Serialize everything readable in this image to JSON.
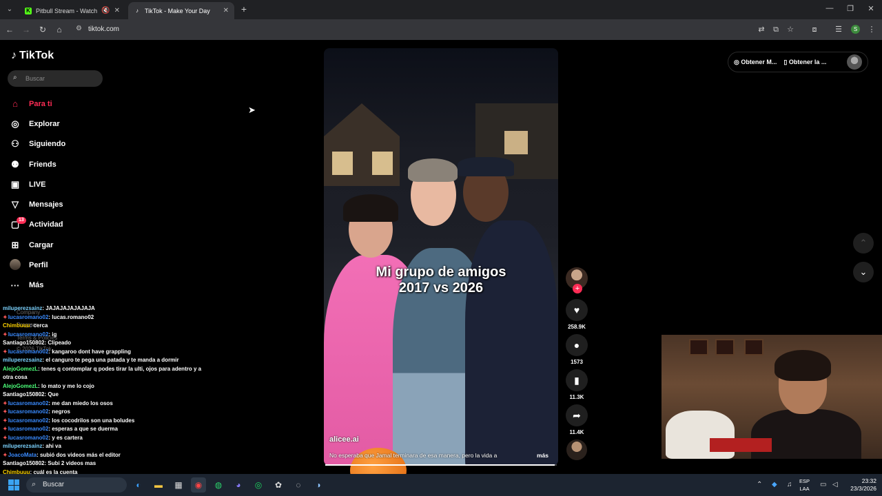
{
  "browser": {
    "tabs": [
      {
        "title": "Pitbull Stream - Watch Live",
        "favicon": "K",
        "color": "#53fc18"
      },
      {
        "title": "TikTok - Make Your Day",
        "favicon": "♪",
        "color": "#ffffff"
      }
    ],
    "url": "tiktok.com"
  },
  "tiktok": {
    "logo": "TikTok",
    "search_placeholder": "Buscar",
    "nav": [
      {
        "label": "Para ti",
        "icon": "home-icon",
        "active": true
      },
      {
        "label": "Explorar",
        "icon": "compass-icon"
      },
      {
        "label": "Siguiendo",
        "icon": "following-icon"
      },
      {
        "label": "Friends",
        "icon": "friends-icon"
      },
      {
        "label": "LIVE",
        "icon": "live-icon"
      },
      {
        "label": "Mensajes",
        "icon": "messages-icon"
      },
      {
        "label": "Actividad",
        "icon": "activity-icon",
        "badge": "13"
      },
      {
        "label": "Cargar",
        "icon": "upload-icon"
      },
      {
        "label": "Perfil",
        "icon": "avatar"
      },
      {
        "label": "Más",
        "icon": "more-icon"
      }
    ],
    "footer_ghost": [
      "Company",
      "Program",
      "Terms & Policies",
      "© 2026 TikTok"
    ],
    "top_buttons": {
      "get_coins": "Obtener M...",
      "get_app": "Obtener la ..."
    },
    "video": {
      "overlay_line1": "Mi grupo de amigos",
      "overlay_line2": "2017 vs 2026",
      "username": "alicee.ai",
      "description": "No esperaba que Jamal terminara de esa manera, pero la vida a",
      "more": "más",
      "progress": 0.99,
      "likes": "258.9K",
      "comments": "1573",
      "saves": "11.3K",
      "shares": "11.4K"
    }
  },
  "chat": [
    {
      "user": "miluperezsainz",
      "color": "#7cd3ff",
      "badges": false,
      "text": "JAJAJAJAJAJAJA"
    },
    {
      "user": "lucasromano02",
      "color": "#3a8bff",
      "badges": true,
      "text": "lucas.romano02"
    },
    {
      "user": "Chimbuuu",
      "color": "#ffd400",
      "badges": false,
      "text": "cerca"
    },
    {
      "user": "lucasromano02",
      "color": "#3a8bff",
      "badges": true,
      "text": "ig"
    },
    {
      "user": "Santiago150802",
      "color": "#ffffff",
      "badges": false,
      "text": "Clipeado"
    },
    {
      "user": "lucasromano02",
      "color": "#3a8bff",
      "badges": true,
      "text": "kangaroo dont have grappling"
    },
    {
      "user": "miluperezsainz",
      "color": "#7cd3ff",
      "badges": false,
      "text": "el canguro te pega una patada y te manda a dormir"
    },
    {
      "user": "AlejoGomezL",
      "color": "#4cff7a",
      "badges": false,
      "text": "tenes q contemplar q podes tirar la ulti, ojos para adentro y a"
    },
    {
      "user": "",
      "color": "#ffffff",
      "badges": false,
      "text": "otra cosa"
    },
    {
      "user": "AlejoGomezL",
      "color": "#4cff7a",
      "badges": false,
      "text": "lo mato y me lo cojo"
    },
    {
      "user": "Santiago150802",
      "color": "#ffffff",
      "badges": false,
      "text": "Que"
    },
    {
      "user": "lucasromano02",
      "color": "#3a8bff",
      "badges": true,
      "text": "me dan miedo los osos"
    },
    {
      "user": "lucasromano02",
      "color": "#3a8bff",
      "badges": true,
      "text": "negros"
    },
    {
      "user": "lucasromano02",
      "color": "#3a8bff",
      "badges": true,
      "text": "los cocodrilos son una boludes"
    },
    {
      "user": "lucasromano02",
      "color": "#3a8bff",
      "badges": true,
      "text": "esperas a que se duerma"
    },
    {
      "user": "lucasromano02",
      "color": "#3a8bff",
      "badges": true,
      "text": "y es cartera"
    },
    {
      "user": "miluperezsainz",
      "color": "#7cd3ff",
      "badges": false,
      "text": "ahi va"
    },
    {
      "user": "JoacoMata",
      "color": "#3a8bff",
      "badges": true,
      "text": "subió dos videos más el editor"
    },
    {
      "user": "Santiago150802",
      "color": "#ffffff",
      "badges": false,
      "text": "Subi 2 videos mas"
    },
    {
      "user": "Chimbuuu",
      "color": "#ffd400",
      "badges": false,
      "text": "cuál es la cuenta"
    }
  ],
  "taskbar": {
    "search_label": "Buscar",
    "lang_line1": "ESP",
    "lang_line2": "LAA",
    "time": "23:32",
    "date": "23/3/2026"
  }
}
